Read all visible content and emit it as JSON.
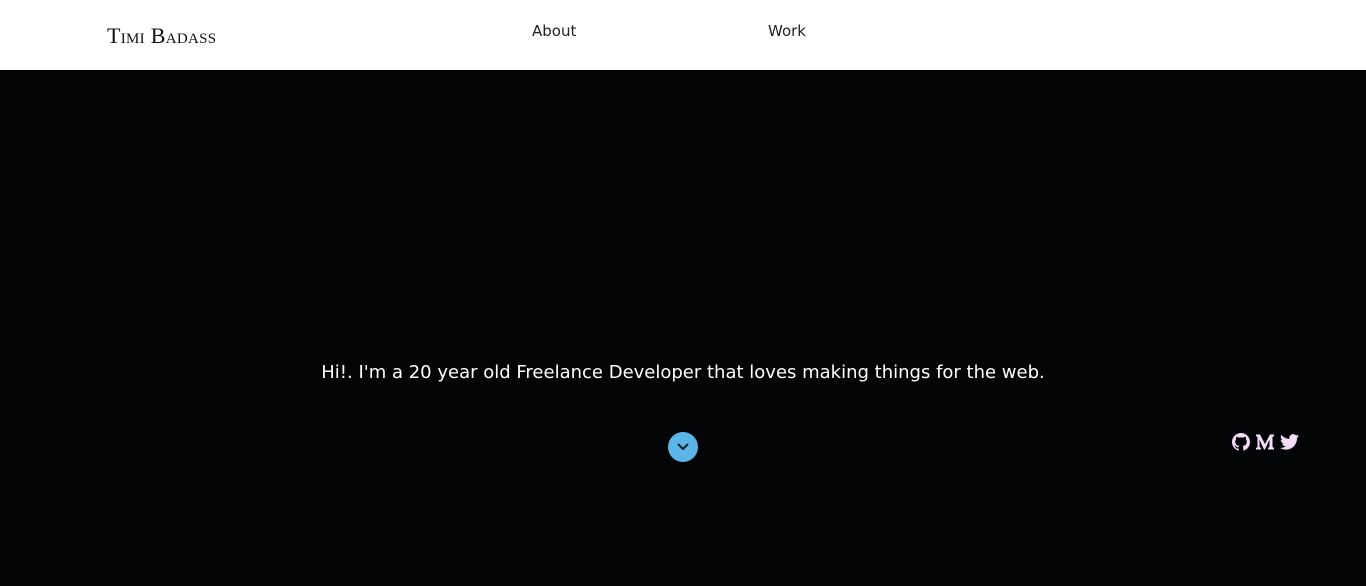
{
  "header": {
    "brand": "Timi Badass",
    "nav": [
      {
        "label": "About"
      },
      {
        "label": "Work"
      }
    ]
  },
  "hero": {
    "tagline": "Hi!. I'm a 20 year old Freelance Developer that loves making things for the web.",
    "scroll_icon": "chevron-down-icon"
  },
  "social": {
    "icons": [
      "github-icon",
      "medium-icon",
      "twitter-icon"
    ]
  },
  "colors": {
    "background": "#020405",
    "navbar": "#ffffff",
    "accent": "#5bb5e6",
    "social_icon": "#f4dcf7"
  }
}
